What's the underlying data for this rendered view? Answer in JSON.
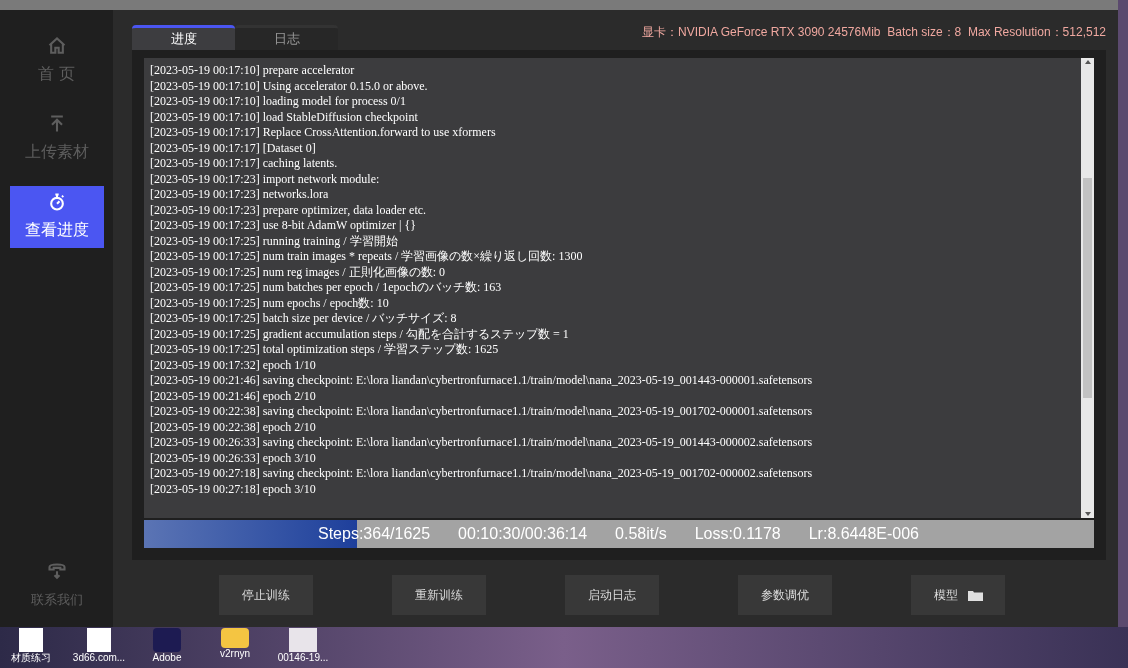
{
  "sidebar": {
    "items": [
      {
        "label": "首 页",
        "selected": false
      },
      {
        "label": "上传素材",
        "selected": false
      },
      {
        "label": "查看进度",
        "selected": true
      }
    ],
    "contact": {
      "label": "联系我们"
    }
  },
  "tabs": [
    {
      "label": "进度",
      "selected": true
    },
    {
      "label": "日志",
      "selected": false
    }
  ],
  "gpu_info": "显卡：NVIDIA GeForce RTX 3090 24576Mib  Batch size：8  Max Resolution：512,512",
  "log_lines": [
    "[2023-05-19 00:17:10] prepare accelerator",
    "[2023-05-19 00:17:10] Using accelerator 0.15.0 or above.",
    "[2023-05-19 00:17:10] loading model for process 0/1",
    "[2023-05-19 00:17:10] load StableDiffusion checkpoint",
    "[2023-05-19 00:17:17] Replace CrossAttention.forward to use xformers",
    "[2023-05-19 00:17:17] [Dataset 0]",
    "[2023-05-19 00:17:17] caching latents.",
    "[2023-05-19 00:17:23] import network module:",
    "[2023-05-19 00:17:23] networks.lora",
    "[2023-05-19 00:17:23] prepare optimizer, data loader etc.",
    "[2023-05-19 00:17:23] use 8-bit AdamW optimizer | {}",
    "[2023-05-19 00:17:25] running training / 学習開始",
    "[2023-05-19 00:17:25] num train images * repeats / 学習画像の数×繰り返し回数: 1300",
    "[2023-05-19 00:17:25] num reg images / 正則化画像の数: 0",
    "[2023-05-19 00:17:25] num batches per epoch / 1epochのバッチ数: 163",
    "[2023-05-19 00:17:25] num epochs / epoch数: 10",
    "[2023-05-19 00:17:25] batch size per device / バッチサイズ: 8",
    "[2023-05-19 00:17:25] gradient accumulation steps / 勾配を合計するステップ数 = 1",
    "[2023-05-19 00:17:25] total optimization steps / 学習ステップ数: 1625",
    "[2023-05-19 00:17:32] epoch 1/10",
    "[2023-05-19 00:21:46] saving checkpoint: E:\\lora liandan\\cybertronfurnace1.1/train/model\\nana_2023-05-19_001443-000001.safetensors",
    "[2023-05-19 00:21:46] epoch 2/10",
    "[2023-05-19 00:22:38] saving checkpoint: E:\\lora liandan\\cybertronfurnace1.1/train/model\\nana_2023-05-19_001702-000001.safetensors",
    "[2023-05-19 00:22:38] epoch 2/10",
    "[2023-05-19 00:26:33] saving checkpoint: E:\\lora liandan\\cybertronfurnace1.1/train/model\\nana_2023-05-19_001443-000002.safetensors",
    "[2023-05-19 00:26:33] epoch 3/10",
    "[2023-05-19 00:27:18] saving checkpoint: E:\\lora liandan\\cybertronfurnace1.1/train/model\\nana_2023-05-19_001702-000002.safetensors",
    "[2023-05-19 00:27:18] epoch 3/10"
  ],
  "progress": {
    "level": 0.224,
    "steps": "Steps:364/1625",
    "time": "00:10:30/00:36:14",
    "speed": "0.58it/s",
    "loss": "Loss:0.1178",
    "lr": "Lr:8.6448E-006"
  },
  "buttons": [
    {
      "label": "停止训练",
      "kind": "text"
    },
    {
      "label": "重新训练",
      "kind": "text"
    },
    {
      "label": "启动日志",
      "kind": "text"
    },
    {
      "label": "参数调优",
      "kind": "text"
    },
    {
      "label": "模型",
      "kind": "folder"
    }
  ],
  "desktop_icons": [
    {
      "label": "材质练习",
      "kind": "file"
    },
    {
      "label": "3d66.com...",
      "kind": "file"
    },
    {
      "label": "Adobe",
      "kind": "app"
    },
    {
      "label": "v2rnyn",
      "kind": "folder"
    },
    {
      "label": "00146-19...",
      "kind": "image"
    }
  ]
}
